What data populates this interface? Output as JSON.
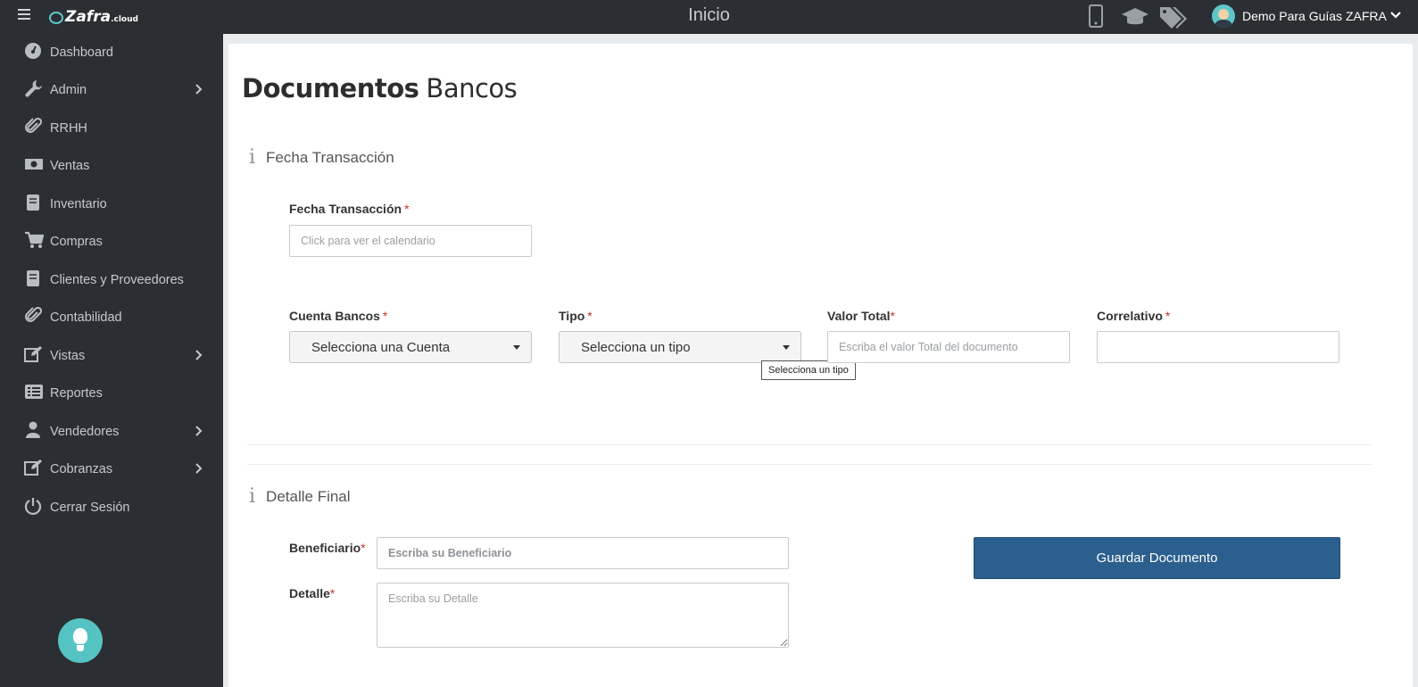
{
  "app": {
    "logo_main": "Zafra",
    "logo_suffix": ".cloud",
    "page_title": "Inicio",
    "user_name": "Demo Para Guías ZAFRA",
    "header_icons": [
      "mobile-icon",
      "graduation-cap-icon",
      "tags-icon"
    ]
  },
  "sidebar": {
    "items": [
      {
        "label": "Dashboard",
        "icon": "dashboard-icon",
        "has_submenu": false
      },
      {
        "label": "Admin",
        "icon": "wrench-icon",
        "has_submenu": true
      },
      {
        "label": "RRHH",
        "icon": "paperclip-icon",
        "has_submenu": false
      },
      {
        "label": "Ventas",
        "icon": "money-icon",
        "has_submenu": false
      },
      {
        "label": "Inventario",
        "icon": "book-icon",
        "has_submenu": false
      },
      {
        "label": "Compras",
        "icon": "cart-icon",
        "has_submenu": false
      },
      {
        "label": "Clientes y Proveedores",
        "icon": "book-icon",
        "has_submenu": false
      },
      {
        "label": "Contabilidad",
        "icon": "paperclip-icon",
        "has_submenu": false
      },
      {
        "label": "Vistas",
        "icon": "edit-icon",
        "has_submenu": true
      },
      {
        "label": "Reportes",
        "icon": "list-icon",
        "has_submenu": false
      },
      {
        "label": "Vendedores",
        "icon": "user-icon",
        "has_submenu": true
      },
      {
        "label": "Cobranzas",
        "icon": "edit-icon",
        "has_submenu": true
      },
      {
        "label": "Cerrar Sesión",
        "icon": "power-icon",
        "has_submenu": false
      }
    ]
  },
  "main": {
    "heading_strong": "Documentos",
    "heading_light": "Bancos",
    "section1": {
      "title": "Fecha Transacción",
      "fecha_label": "Fecha Transacción",
      "fecha_placeholder": "Click para ver el calendario",
      "cuenta_label": "Cuenta Bancos",
      "cuenta_value": "Selecciona una Cuenta",
      "tipo_label": "Tipo",
      "tipo_value": "Selecciona un tipo",
      "tipo_tooltip": "Selecciona un tipo",
      "valor_label": "Valor Total",
      "valor_placeholder": "Escriba el valor Total del documento",
      "correlativo_label": "Correlativo",
      "correlativo_value": ""
    },
    "section2": {
      "title": "Detalle Final",
      "beneficiario_label": "Beneficiario",
      "beneficiario_placeholder": "Escriba su Beneficiario",
      "detalle_label": "Detalle",
      "detalle_placeholder": "Escriba su Detalle",
      "save_button": "Guardar Documento"
    },
    "required_mark": "*"
  },
  "colors": {
    "sidebar_bg": "#2b2f33",
    "primary_button": "#2b5f8d",
    "required": "#c9302c",
    "accent_teal": "#56c3c3"
  }
}
